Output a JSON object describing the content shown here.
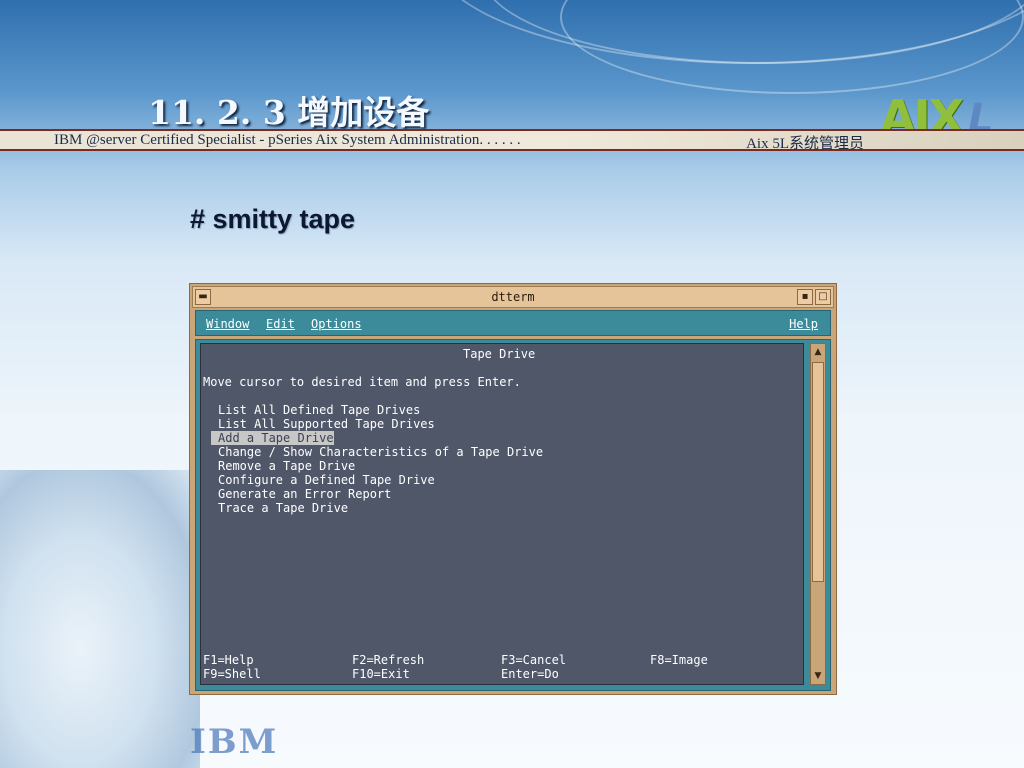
{
  "slide": {
    "title": "11. 2. 3  增加设备",
    "header_left": "IBM @server Certified Specialist - pSeries Aix System Administration. . . . . .",
    "header_right": "Aix 5L系统管理员",
    "logo_aix": "AIX",
    "logo_l": "L",
    "logo_ibm": "IBM",
    "command": "# smitty tape"
  },
  "window": {
    "title": "dtterm",
    "minimize_icon": "minimize-icon",
    "maximize_icon": "maximize-icon",
    "menu": {
      "window": "Window",
      "edit": "Edit",
      "options": "Options",
      "help": "Help"
    }
  },
  "terminal": {
    "heading": "Tape Drive",
    "prompt": "Move cursor to desired item and press Enter.",
    "items": [
      "List All Defined Tape Drives",
      "List All Supported Tape Drives",
      "Add a Tape Drive",
      "Change / Show Characteristics of a Tape Drive",
      "Remove a Tape Drive",
      "Configure a Defined Tape Drive",
      "Generate an Error Report",
      "Trace a Tape Drive"
    ],
    "selected_index": 2,
    "fkeys": {
      "f1": "F1=Help",
      "f2": "F2=Refresh",
      "f3": "F3=Cancel",
      "f8": "F8=Image",
      "f9": "F9=Shell",
      "f10": "F10=Exit",
      "enter": "Enter=Do"
    }
  },
  "colors": {
    "menubar": "#3c8b9a",
    "terminal_bg": "#4f5769",
    "window_frame": "#c9a67a",
    "highlight": "#c7c7c7"
  }
}
